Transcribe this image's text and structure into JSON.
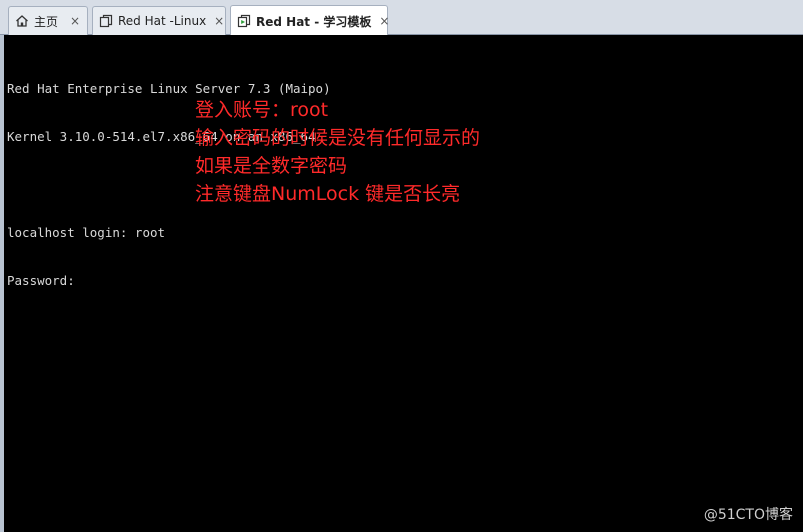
{
  "tabs": [
    {
      "label": "主页",
      "icon": "home-icon",
      "active": false
    },
    {
      "label": "Red Hat -Linux",
      "icon": "vm-icon",
      "active": false
    },
    {
      "label": "Red Hat - 学习模板",
      "icon": "vm-running-icon",
      "active": true
    }
  ],
  "tab_close_glyph": "×",
  "console": {
    "lines": [
      "Red Hat Enterprise Linux Server 7.3 (Maipo)",
      "Kernel 3.10.0-514.el7.x86_64 on an x86_64",
      "",
      "localhost login: root",
      "Password:"
    ]
  },
  "annotation": {
    "color": "#ff2a2a",
    "lines": [
      "登入账号：root",
      "输入密码的时候是没有任何显示的",
      "如果是全数字密码",
      "注意键盘NumLock 键是否长亮"
    ]
  },
  "watermark": "@51CTO博客"
}
